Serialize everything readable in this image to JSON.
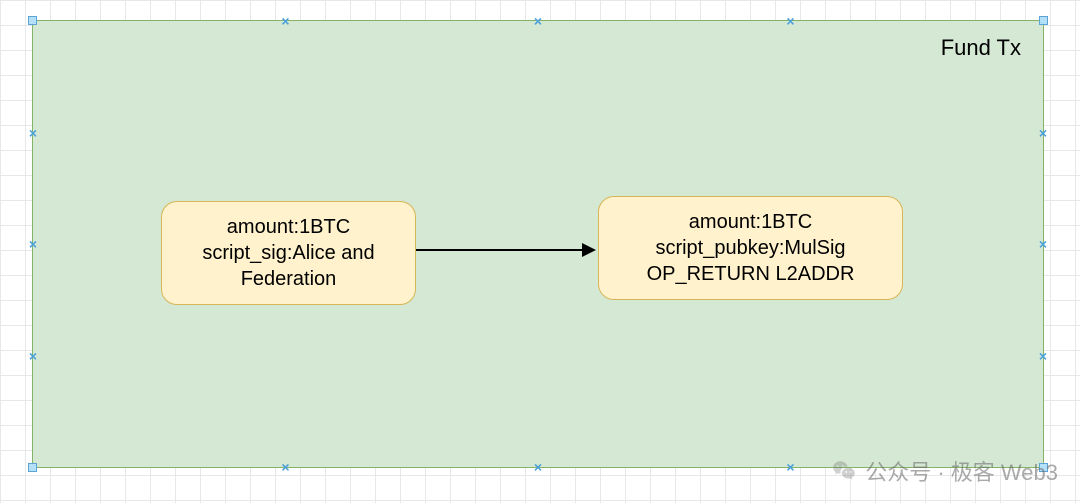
{
  "diagram": {
    "container_title": "Fund Tx",
    "input_node": {
      "line1": "amount:1BTC",
      "line2": "script_sig:Alice and",
      "line3": "Federation"
    },
    "output_node": {
      "line1": "amount:1BTC",
      "line2": "script_pubkey:MulSig",
      "line3": "OP_RETURN L2ADDR"
    }
  },
  "watermark": {
    "text": "公众号 · 极客 Web3"
  },
  "colors": {
    "container_fill": "#d5e8d4",
    "container_stroke": "#82b366",
    "node_fill": "#fff2cc",
    "node_stroke": "#d6b656",
    "handle_fill": "#b3e0f7",
    "grid": "#e8e8e8"
  }
}
